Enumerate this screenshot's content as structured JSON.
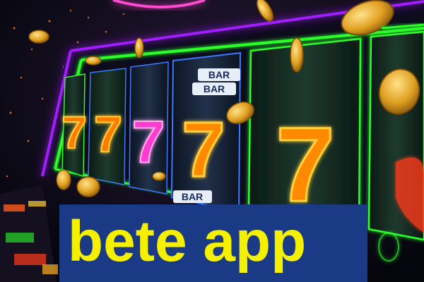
{
  "reel_symbols": [
    "7",
    "7",
    "7",
    "7",
    "7"
  ],
  "reel_labels": [
    "BAR",
    "BAR",
    "BAR"
  ],
  "caption": "bete app",
  "colors": {
    "background": "#05060d",
    "neon_purple": "#a21cff",
    "neon_green": "#2bff2b",
    "neon_blue": "#3a7bff",
    "seven_orange": "#ff8a00",
    "seven_glow": "#ffd23a",
    "caption_text": "#f5f000",
    "caption_bg": "#1b3a86"
  },
  "icons": [
    "slot-machine-icon",
    "coin-icon"
  ]
}
